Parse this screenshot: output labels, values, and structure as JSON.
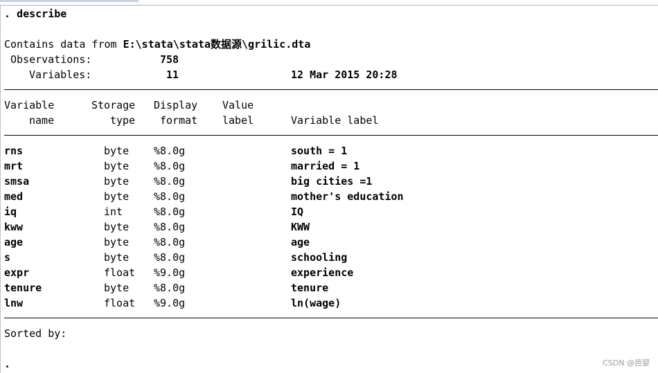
{
  "command": ". describe",
  "contains_prefix": "Contains data from ",
  "file_path": "E:\\stata\\stata数据源\\grilic.dta",
  "obs_label": "Observations:",
  "obs_value": "758",
  "vars_label": "Variables:",
  "vars_value": "11",
  "timestamp": "12 Mar 2015 20:28",
  "headers": {
    "variable_1": "Variable",
    "variable_2": "name",
    "storage_1": "Storage",
    "storage_2": "type",
    "display_1": "Display",
    "display_2": "format",
    "value_1": "Value",
    "value_2": "label",
    "varlabel": "Variable label"
  },
  "rows": [
    {
      "name": "rns",
      "type": "byte",
      "format": "%8.0g",
      "label": "south = 1"
    },
    {
      "name": "mrt",
      "type": "byte",
      "format": "%8.0g",
      "label": "married = 1"
    },
    {
      "name": "smsa",
      "type": "byte",
      "format": "%8.0g",
      "label": "big cities =1"
    },
    {
      "name": "med",
      "type": "byte",
      "format": "%8.0g",
      "label": "mother's education"
    },
    {
      "name": "iq",
      "type": "int",
      "format": "%8.0g",
      "label": "IQ"
    },
    {
      "name": "kww",
      "type": "byte",
      "format": "%8.0g",
      "label": "KWW"
    },
    {
      "name": "age",
      "type": "byte",
      "format": "%8.0g",
      "label": "age"
    },
    {
      "name": "s",
      "type": "byte",
      "format": "%8.0g",
      "label": "schooling"
    },
    {
      "name": "expr",
      "type": "float",
      "format": "%9.0g",
      "label": "experience"
    },
    {
      "name": "tenure",
      "type": "byte",
      "format": "%8.0g",
      "label": "tenure"
    },
    {
      "name": "lnw",
      "type": "float",
      "format": "%9.0g",
      "label": "ln(wage)"
    }
  ],
  "sorted_label": "Sorted by:",
  "prompt": ".",
  "watermark": "CSDN @芭婴"
}
